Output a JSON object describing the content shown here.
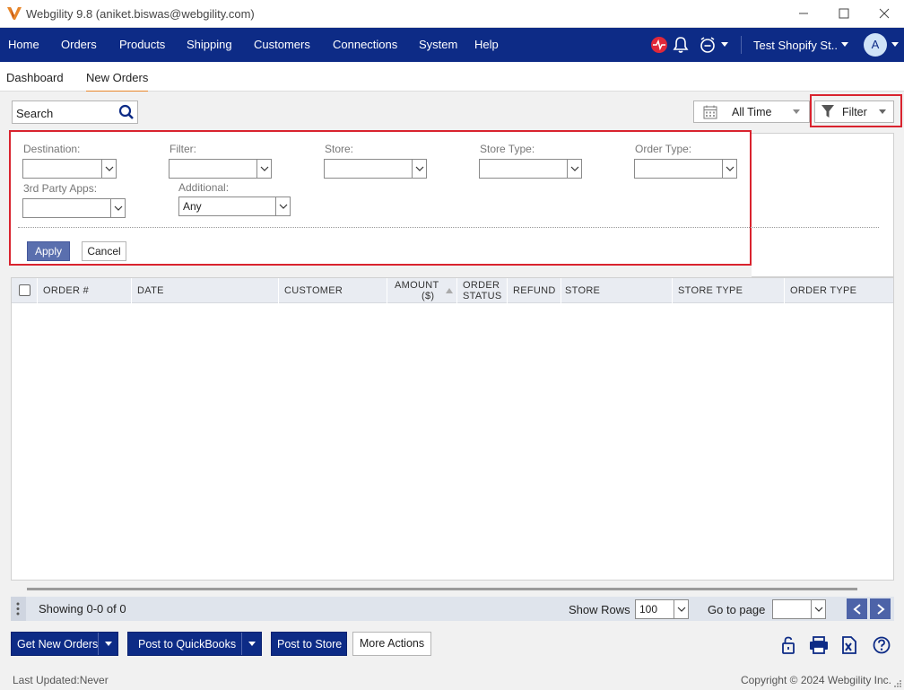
{
  "window": {
    "title": "Webgility 9.8 (aniket.biswas@webgility.com)"
  },
  "nav": {
    "items": [
      "Home",
      "Orders",
      "Products",
      "Shipping",
      "Customers",
      "Connections",
      "System",
      "Help"
    ],
    "store": "Test Shopify St..",
    "avatar": "A"
  },
  "tabs": {
    "dashboard": "Dashboard",
    "new_orders": "New Orders"
  },
  "search": {
    "placeholder": "Search"
  },
  "date_filter": {
    "value": "All Time"
  },
  "filter_button": {
    "label": "Filter"
  },
  "filter_panel": {
    "destination": "Destination:",
    "filter": "Filter:",
    "store": "Store:",
    "store_type": "Store Type:",
    "order_type": "Order Type:",
    "third_party": "3rd Party Apps:",
    "additional": "Additional:",
    "additional_value": "Any",
    "apply": "Apply",
    "cancel": "Cancel"
  },
  "grid": {
    "columns": [
      "ORDER #",
      "DATE",
      "CUSTOMER",
      "AMOUNT",
      "($)",
      "ORDER",
      "STATUS",
      "REFUND",
      "STORE",
      "STORE TYPE",
      "ORDER TYPE"
    ]
  },
  "pager": {
    "showing": "Showing 0-0 of 0",
    "show_rows_label": "Show Rows",
    "rows_value": "100",
    "goto_label": "Go to page"
  },
  "actions": {
    "get_new_orders": "Get New Orders",
    "post_to_quickbooks": "Post to QuickBooks",
    "post_to_store": "Post to Store",
    "more_actions": "More Actions"
  },
  "footer": {
    "last_updated": "Last Updated:Never",
    "copyright": "Copyright © 2024 Webgility Inc."
  },
  "colors": {
    "nav_bg": "#0d2b86",
    "highlight": "#d9232e",
    "tab_underline": "#e8862a"
  }
}
